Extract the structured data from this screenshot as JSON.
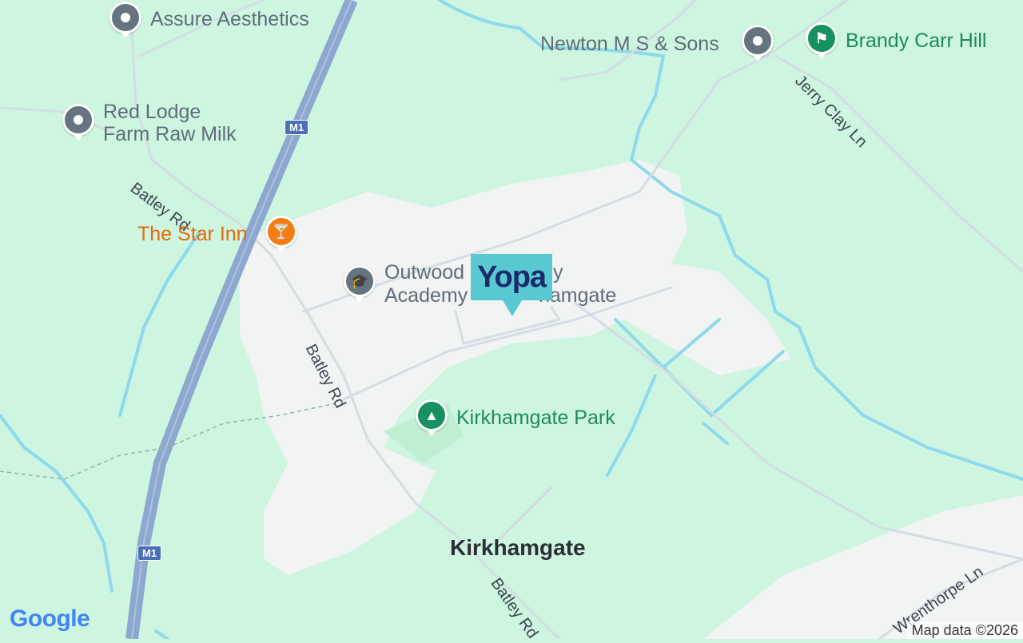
{
  "map": {
    "poi": {
      "assure": "Assure Aesthetics",
      "newton": "Newton M S & Sons",
      "brandy": "Brandy Carr Hill",
      "red_lodge_1": "Red Lodge",
      "red_lodge_2": "Farm Raw Milk",
      "star_inn": "The Star Inn",
      "outwood_1": "Outwood",
      "outwood_1b": "y",
      "outwood_2": "Academy",
      "outwood_2b": "hamgate",
      "park": "Kirkhamgate Park"
    },
    "place": {
      "town": "Kirkhamgate"
    },
    "roads": {
      "batley_1": "Batley Rd",
      "batley_2": "Batley Rd",
      "batley_3": "Batley Rd",
      "jerry_clay": "Jerry Clay Ln",
      "wrenthorpe": "Wrenthorpe Ln",
      "m1_top": "M1",
      "m1_bottom": "M1"
    },
    "marker": {
      "label": "Yopa"
    },
    "footer": {
      "logo": "Google",
      "attribution": "Map data ©2026"
    },
    "icons": {
      "generic": "location-dot-icon",
      "hiking": "hiking-icon",
      "cocktail": "cocktail-icon",
      "school": "graduation-cap-icon",
      "park": "tree-icon"
    },
    "colors": {
      "land": "#cdf5df",
      "urban": "#f2f3f3",
      "water": "#8ed9ec",
      "motorway": "#8ea7cf",
      "road": "#d3dde3",
      "brand": "#58c8d2",
      "brand_text": "#1b2a6b"
    }
  }
}
